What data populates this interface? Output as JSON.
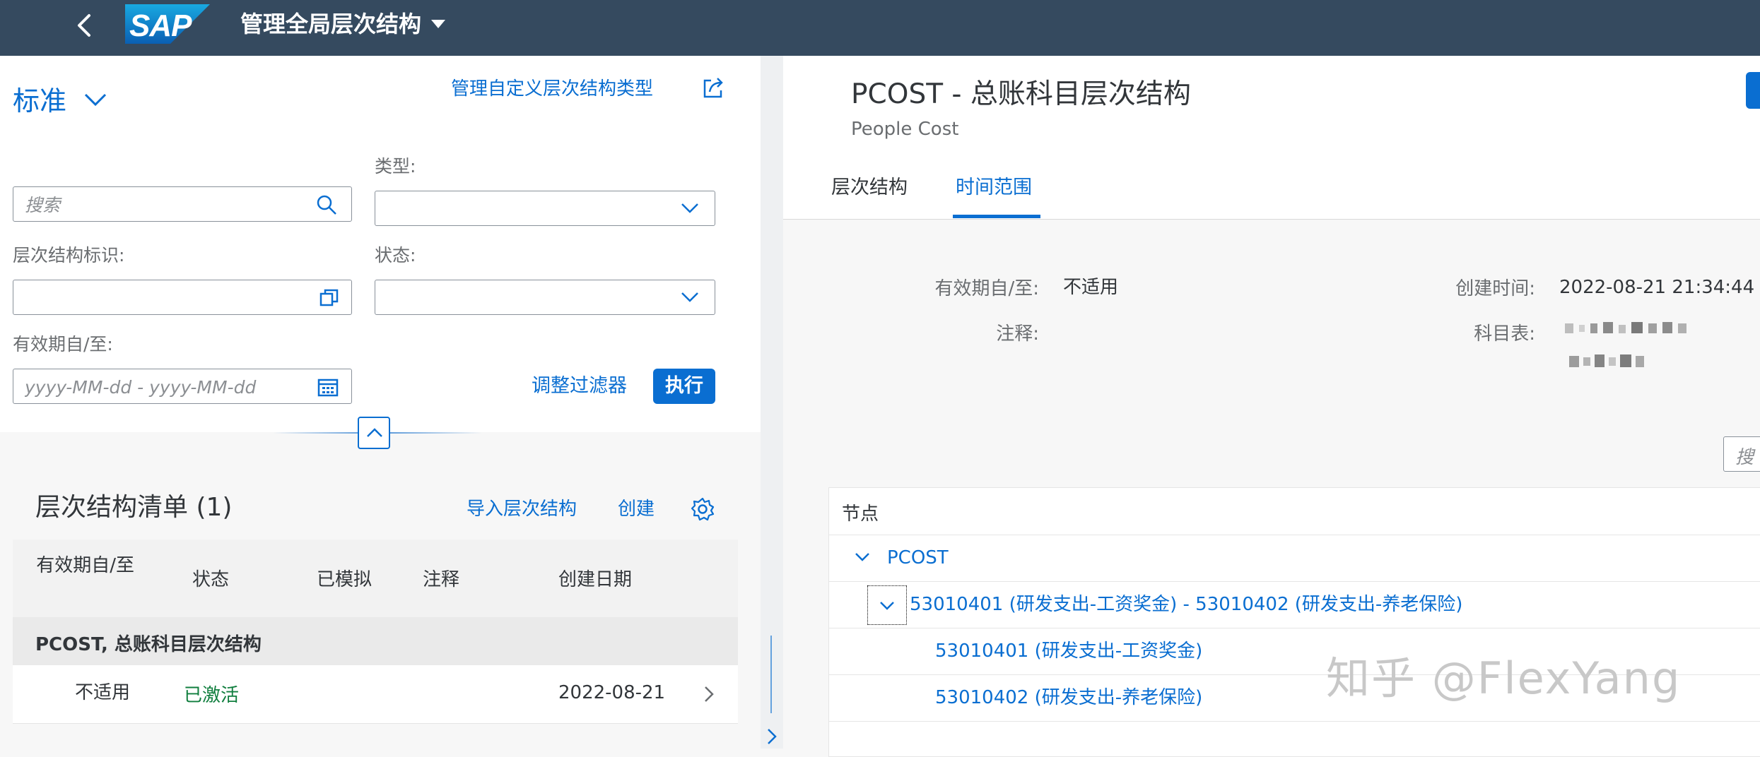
{
  "shell": {
    "app_title": "管理全局层次结构",
    "logo_text": "SAP",
    "brand_color": "#354a5f"
  },
  "filter_bar": {
    "variant": "标准",
    "manage_link": "管理自定义层次结构类型",
    "search_placeholder": "搜索",
    "type_label": "类型:",
    "hierarchy_id_label": "层次结构标识:",
    "status_label": "状态:",
    "valid_label": "有效期自/至:",
    "date_placeholder": "yyyy-MM-dd - yyyy-MM-dd",
    "adjust_filters": "调整过滤器",
    "go_button": "执行"
  },
  "hierarchy_list": {
    "title": "层次结构清单 (1)",
    "import_link": "导入层次结构",
    "create_link": "创建",
    "columns": [
      "有效期自/至",
      "状态",
      "已模拟",
      "注释",
      "创建日期"
    ],
    "group": "PCOST, 总账科目层次结构",
    "rows": [
      {
        "valid": "不适用",
        "status": "已激活",
        "simulated": "",
        "note": "",
        "created": "2022-08-21"
      }
    ]
  },
  "detail": {
    "title": "PCOST - 总账科目层次结构",
    "subtitle": "People Cost",
    "tabs": [
      "层次结构",
      "时间范围"
    ],
    "selected_tab": 1,
    "valid_label": "有效期自/至:",
    "valid_value": "不适用",
    "note_label": "注释:",
    "note_value": "",
    "created_label": "创建时间:",
    "created_value": "2022-08-21 21:34:44",
    "coa_label": "科目表:",
    "search_placeholder": "搜",
    "tree_header": "节点",
    "nodes": [
      "PCOST",
      "53010401 (研发支出-工资奖金) - 53010402 (研发支出-养老保险)",
      "53010401 (研发支出-工资奖金)",
      "53010402 (研发支出-养老保险)"
    ]
  },
  "watermark": "知乎 @FlexYang",
  "colors": {
    "accent": "#0a6ed1",
    "success": "#107e3e",
    "text": "#32363a",
    "label": "#6a6d70"
  }
}
